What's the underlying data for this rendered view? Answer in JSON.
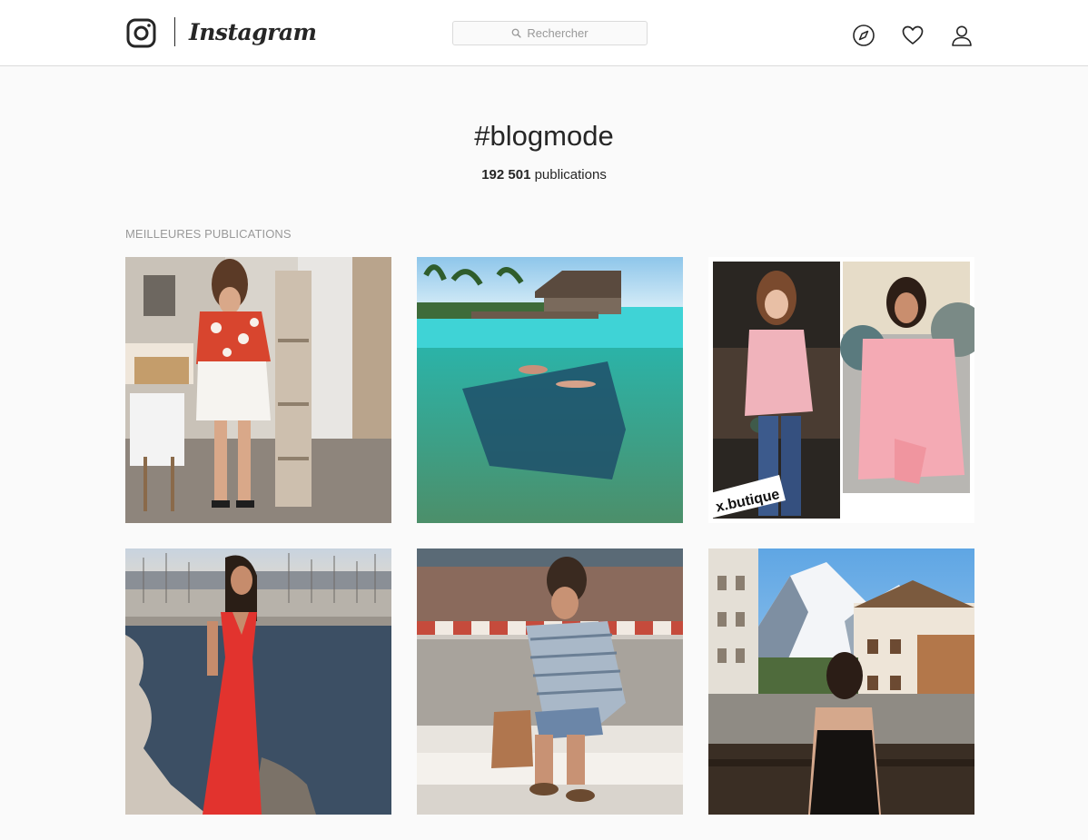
{
  "header": {
    "wordmark": "Instagram",
    "search": {
      "placeholder": "Rechercher"
    },
    "icons": [
      "instagram-glyph-icon",
      "explore-compass-icon",
      "activity-heart-icon",
      "profile-icon"
    ]
  },
  "tag": {
    "title": "#blogmode",
    "count_number": "192 501",
    "count_label": "publications"
  },
  "top_posts": {
    "label": "MEILLEURES PUBLICATIONS",
    "posts": [
      {
        "overlay_text": ""
      },
      {
        "overlay_text": ""
      },
      {
        "overlay_text": "x.butique"
      },
      {
        "overlay_text": ""
      },
      {
        "overlay_text": ""
      },
      {
        "overlay_text": ""
      }
    ]
  },
  "colors": {
    "background": "#fafafa",
    "header_bg": "#ffffff",
    "border": "#dbdbdb",
    "text": "#262626",
    "muted": "#999999"
  }
}
